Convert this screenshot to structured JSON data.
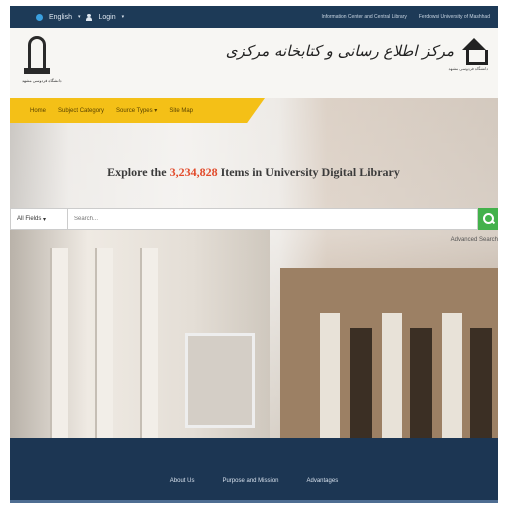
{
  "topbar": {
    "language": "English",
    "login": "Login",
    "links": [
      "Information Center and Central Library",
      "Ferdowsi University of Mashhad"
    ]
  },
  "header": {
    "right_logo_text": "مرکز اطلاع رسانی و کتابخانه مرکزی",
    "right_logo_sub": "دانشگاه فردوسی مشهد",
    "left_logo_sub": "دانشگاه فردوسی مشهد"
  },
  "nav": {
    "items": [
      "Home",
      "Subject Category",
      "Source Types",
      "Site Map"
    ]
  },
  "hero": {
    "explore_prefix": "Explore the ",
    "explore_count": "3,234,828",
    "explore_suffix": " Items in University Digital Library"
  },
  "search": {
    "fields_label": "All Fields",
    "placeholder": "Search...",
    "advanced_label": "Advanced Search"
  },
  "footer": {
    "links": [
      "About Us",
      "Purpose and Mission",
      "Advantages"
    ]
  },
  "colors": {
    "topbar": "#1d3a57",
    "nav": "#f4c017",
    "search_button": "#43b14b",
    "count": "#e24a2a",
    "footer": "#1c3653"
  },
  "icons": [
    "globe-icon",
    "user-icon",
    "search-icon",
    "library-logo-icon",
    "university-logo-icon"
  ]
}
